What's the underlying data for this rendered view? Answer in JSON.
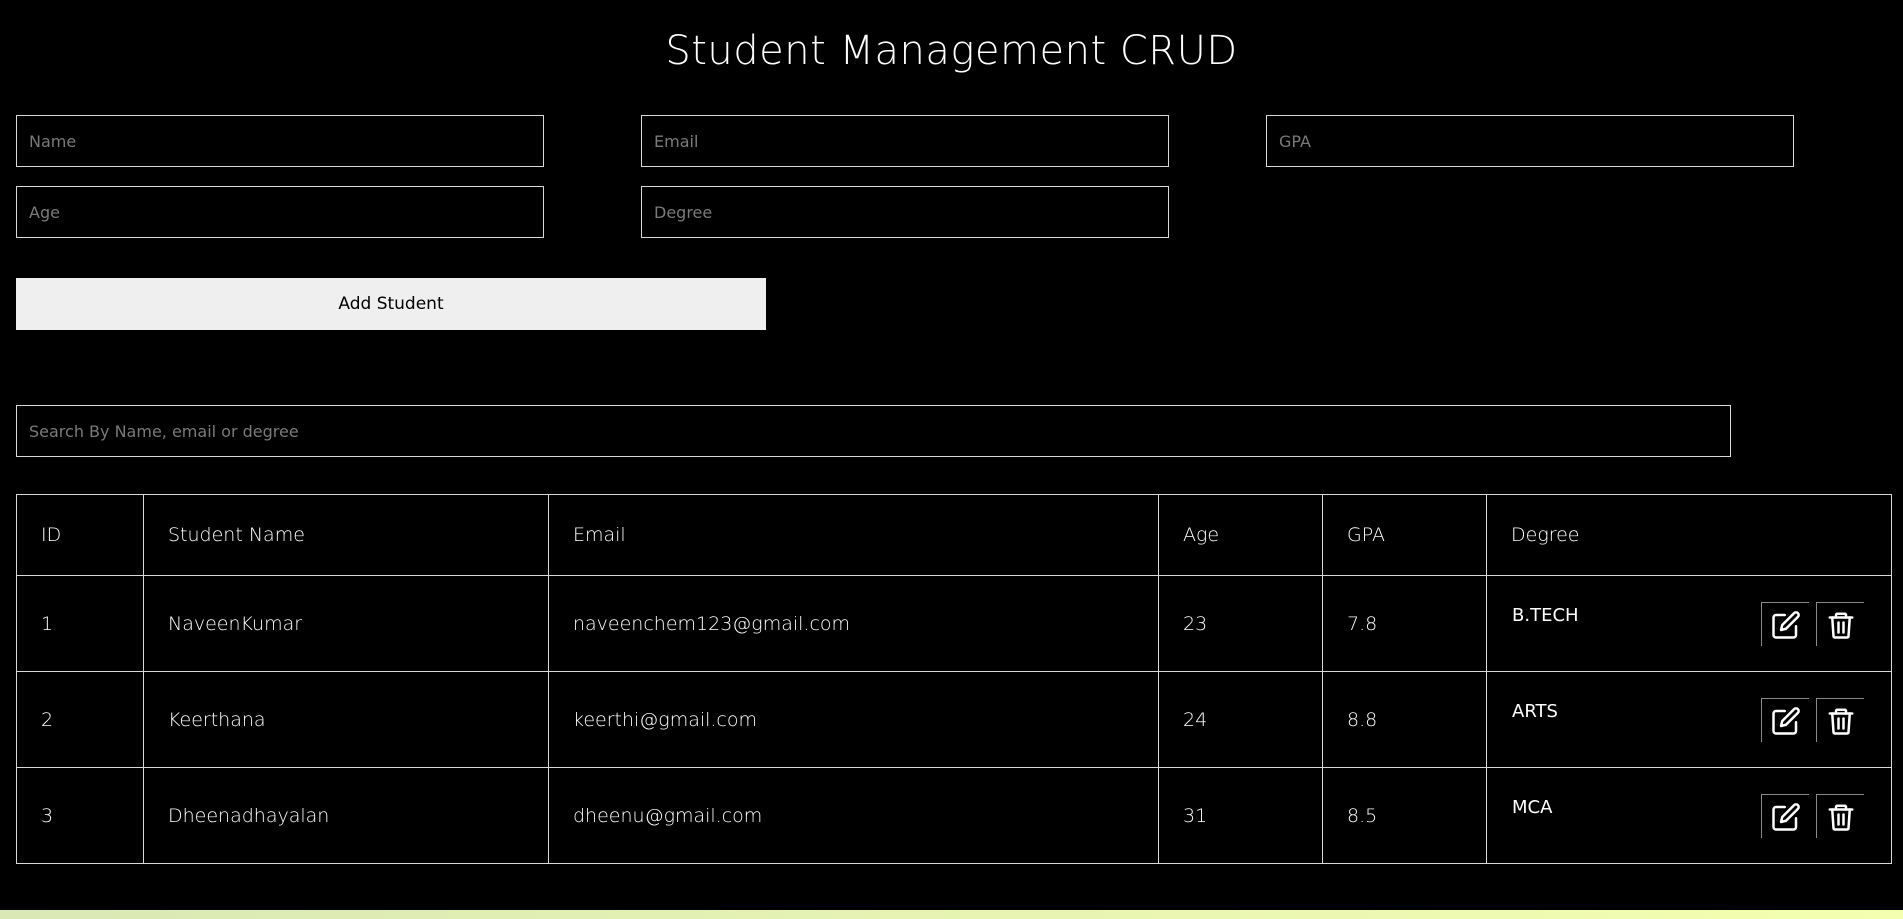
{
  "title": "Student Management CRUD",
  "form": {
    "name_placeholder": "Name",
    "email_placeholder": "Email",
    "gpa_placeholder": "GPA",
    "age_placeholder": "Age",
    "degree_placeholder": "Degree",
    "add_label": "Add Student"
  },
  "search": {
    "placeholder": "Search By Name, email or degree"
  },
  "table": {
    "headers": [
      "ID",
      "Student Name",
      "Email",
      "Age",
      "GPA",
      "Degree"
    ],
    "rows": [
      {
        "id": "1",
        "name": "NaveenKumar",
        "email": "naveenchem123@gmail.com",
        "age": "23",
        "gpa": "7.8",
        "degree": "B.TECH"
      },
      {
        "id": "2",
        "name": "Keerthana",
        "email": "keerthi@gmail.com",
        "age": "24",
        "gpa": "8.8",
        "degree": "ARTS"
      },
      {
        "id": "3",
        "name": "Dheenadhayalan",
        "email": "dheenu@gmail.com",
        "age": "31",
        "gpa": "8.5",
        "degree": "MCA"
      }
    ]
  },
  "icons": {
    "edit": "edit-icon",
    "delete": "trash-icon"
  },
  "colors": {
    "background": "#000000",
    "text": "#ffffff",
    "button_bg": "#efefef",
    "border": "#d8d8d8"
  }
}
